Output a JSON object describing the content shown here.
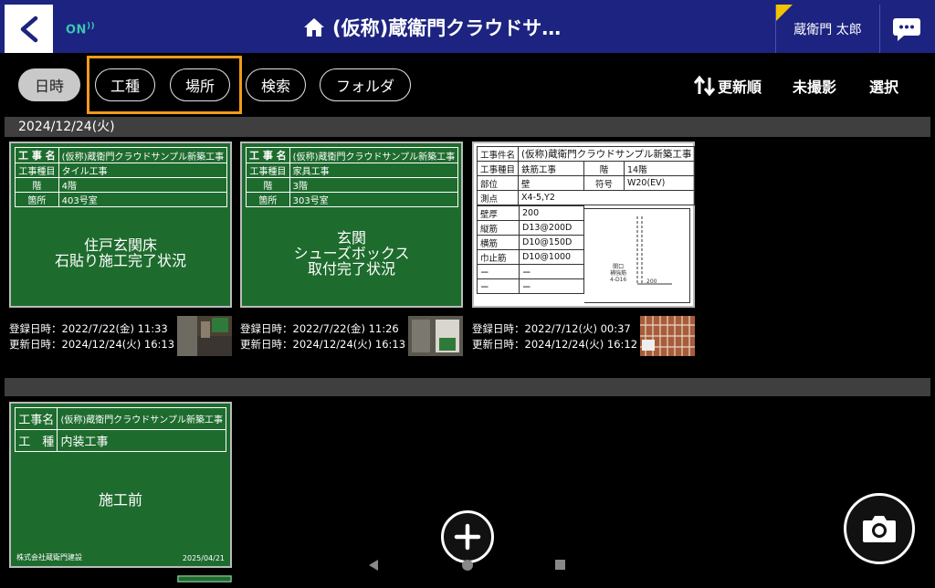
{
  "header": {
    "status": "ON",
    "title": "(仮称)蔵衛門クラウドサ…",
    "user": "蔵衛門 太郎"
  },
  "toolbar": {
    "filters": [
      "日時",
      "工種",
      "場所",
      "検索",
      "フォルダ"
    ],
    "sort_label": "更新順",
    "unshot_label": "未撮影",
    "select_label": "選択"
  },
  "groups": {
    "date_label": "2024/12/24(火)"
  },
  "photos": [
    {
      "rows": [
        [
          "工 事 名",
          "(仮称)蔵衛門クラウドサンプル新築工事"
        ],
        [
          "工事種目",
          "タイル工事"
        ],
        [
          "階",
          "4階"
        ],
        [
          "箇所",
          "403号室"
        ]
      ],
      "body": [
        "住戸玄関床",
        "石貼り施工完了状況"
      ],
      "registered": "登録日時：2022/7/22(金) 11:33",
      "updated": "更新日時：2024/12/24(火) 16:13"
    },
    {
      "rows": [
        [
          "工 事 名",
          "(仮称)蔵衛門クラウドサンプル新築工事"
        ],
        [
          "工事種目",
          "家具工事"
        ],
        [
          "階",
          "3階"
        ],
        [
          "箇所",
          "303号室"
        ]
      ],
      "body": [
        "玄関",
        "シューズボックス",
        "取付完了状況"
      ],
      "registered": "登録日時：2022/7/22(金) 11:26",
      "updated": "更新日時：2024/12/24(火) 16:13"
    },
    {
      "project_label": "工事件名",
      "project": "(仮称)蔵衛門クラウドサンプル新築工事",
      "rows": [
        [
          "工事種目",
          "鉄筋工事",
          "階",
          "14階"
        ],
        [
          "部位",
          "壁",
          "符号",
          "W20(EV)"
        ],
        [
          "測点",
          "X4-5,Y2",
          "",
          ""
        ],
        [
          "壁厚",
          "200"
        ],
        [
          "縦筋",
          "D13@200D"
        ],
        [
          "横筋",
          "D10@150D"
        ],
        [
          "巾止筋",
          "D10@1000"
        ],
        [
          "ー",
          "ー"
        ],
        [
          "ー",
          "ー"
        ]
      ],
      "sketch_note": [
        "開口",
        "補強筋",
        "4-D16"
      ],
      "sketch_dim": "200",
      "registered": "登録日時：2022/7/12(火) 00:37",
      "updated": "更新日時：2024/12/24(火) 16:12"
    },
    {
      "rows": [
        [
          "工事名",
          "(仮称)蔵衛門クラウドサンプル新築工事"
        ],
        [
          "工　種",
          "内装工事"
        ]
      ],
      "body": [
        "施工前"
      ],
      "company": "株式会社蔵衛門建設",
      "date": "2025/04/21"
    }
  ],
  "colors": {
    "header": "#1d2380",
    "board_green": "#1e6b2e",
    "highlight": "#f19a1b",
    "online": "#39c7b0"
  },
  "icons": [
    "back-arrow-icon",
    "wifi-icon",
    "home-icon",
    "chat-icon",
    "sort-arrows-icon",
    "plus-icon",
    "camera-icon"
  ]
}
